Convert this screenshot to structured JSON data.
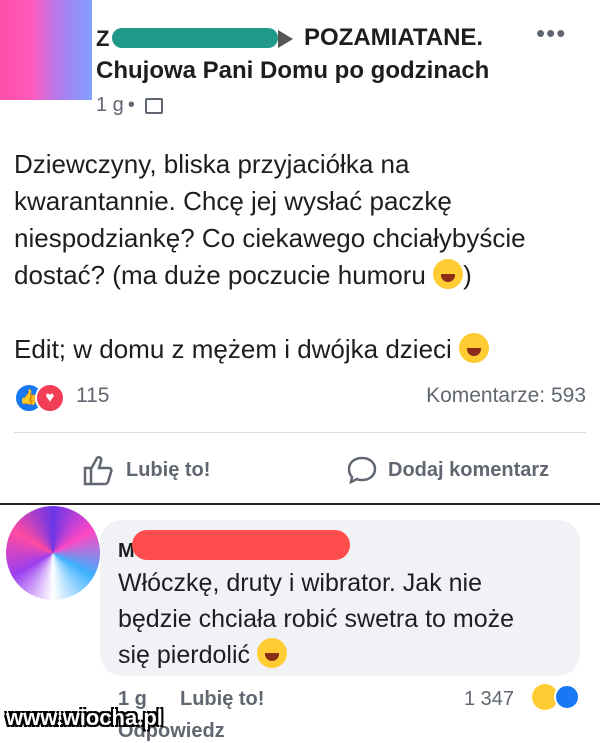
{
  "header": {
    "author_initial": "Z",
    "group_name": "POZAMIATANE.",
    "group_subtitle": "Chujowa Pani Domu po godzinach",
    "time": "1 g",
    "dot": "•",
    "more": "•••"
  },
  "post": {
    "text_lines": [
      "Dziewczyny, bliska przyjaciółka na",
      "kwarantannie. Chcę jej wysłać paczkę",
      "niespodziankę? Co ciekawego chciałybyście",
      "dostać? (ma duże poczucie humoru",
      ")"
    ],
    "edit_line": "Edit; w domu z mężem i dwójka dzieci",
    "reaction_count": "115",
    "comments_label": "Komentarze: 593",
    "like_label": "Lubię to!",
    "comment_label": "Dodaj komentarz"
  },
  "comment": {
    "author_initial": "M",
    "lines": [
      "Włóczkę, druty i wibrator. Jak nie",
      "będzie chciała robić swetra to może",
      "się pierdolić"
    ],
    "time": "1 g",
    "like_label": "Lubię to!",
    "reply_label": "Odpowiedz",
    "reaction_count": "1 347"
  },
  "watermark": "www.wiocha.pl",
  "colors": {
    "like_blue": "#1877f2",
    "love_red": "#f33e58",
    "redaction_teal": "#1f9a8a",
    "redaction_red": "#ff4d4d",
    "bubble_gray": "#f0f2f5"
  },
  "icons": [
    "like-icon",
    "love-icon",
    "thumbs-up-outline-icon",
    "comment-bubble-icon",
    "globe-icon",
    "laughing-emoji-icon",
    "grinning-emoji-icon"
  ]
}
